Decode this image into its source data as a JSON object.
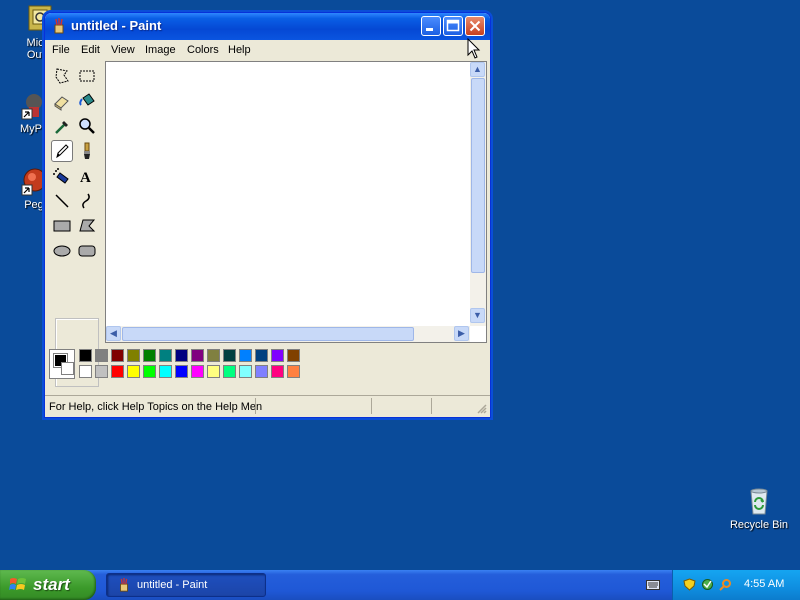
{
  "desktop": {
    "icons": [
      {
        "label": "Micro\nOutlo",
        "icon": "outlook-icon"
      },
      {
        "label": "MyPa",
        "icon": "mypaint-icon"
      },
      {
        "label": "Peg",
        "icon": "pegasus-icon"
      },
      {
        "label": "Recycle Bin",
        "icon": "recycle-bin-icon"
      }
    ]
  },
  "window": {
    "title": "untitled - Paint",
    "menu": [
      "File",
      "Edit",
      "View",
      "Image",
      "Colors",
      "Help"
    ],
    "tools": [
      {
        "name": "free-form-select",
        "icon": "free-select-icon"
      },
      {
        "name": "rect-select",
        "icon": "rect-select-icon"
      },
      {
        "name": "eraser",
        "icon": "eraser-icon"
      },
      {
        "name": "fill",
        "icon": "fill-bucket-icon"
      },
      {
        "name": "pick-color",
        "icon": "eyedropper-icon"
      },
      {
        "name": "magnifier",
        "icon": "magnifier-icon"
      },
      {
        "name": "pencil",
        "icon": "pencil-icon",
        "active": true
      },
      {
        "name": "brush",
        "icon": "brush-icon"
      },
      {
        "name": "airbrush",
        "icon": "airbrush-icon"
      },
      {
        "name": "text",
        "icon": "text-icon"
      },
      {
        "name": "line",
        "icon": "line-icon"
      },
      {
        "name": "curve",
        "icon": "curve-icon"
      },
      {
        "name": "rectangle",
        "icon": "rectangle-icon"
      },
      {
        "name": "polygon",
        "icon": "polygon-icon"
      },
      {
        "name": "ellipse",
        "icon": "ellipse-icon"
      },
      {
        "name": "rounded-rectangle",
        "icon": "rounded-rect-icon"
      }
    ],
    "palette_top": [
      "#000000",
      "#808080",
      "#800000",
      "#808000",
      "#008000",
      "#008080",
      "#000080",
      "#800080",
      "#808040",
      "#004040",
      "#0080ff",
      "#004080",
      "#8000ff",
      "#804000"
    ],
    "palette_bottom": [
      "#ffffff",
      "#c0c0c0",
      "#ff0000",
      "#ffff00",
      "#00ff00",
      "#00ffff",
      "#0000ff",
      "#ff00ff",
      "#ffff80",
      "#00ff80",
      "#80ffff",
      "#8080ff",
      "#ff0080",
      "#ff8040"
    ],
    "foreground": "#000000",
    "background": "#ffffff",
    "status": "For Help, click Help Topics on the Help Men"
  },
  "taskbar": {
    "start_label": "start",
    "task_label": "untitled - Paint",
    "clock": "4:55 AM"
  }
}
